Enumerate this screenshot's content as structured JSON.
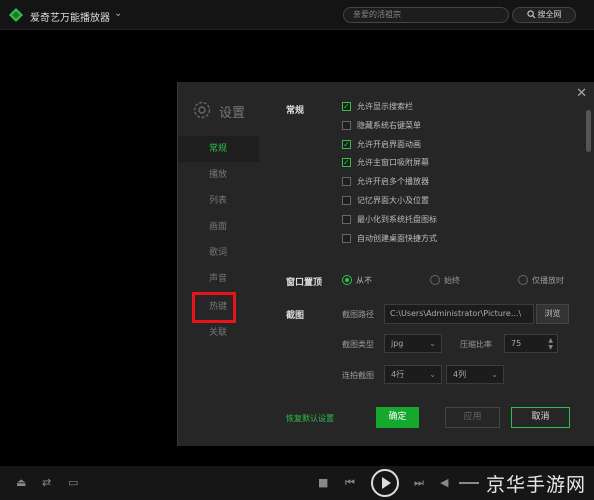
{
  "app": {
    "title": "爱奇艺万能播放器",
    "search_placeholder": "亲爱的活祖宗",
    "search_button": "搜全网"
  },
  "settings": {
    "title": "设置",
    "sidebar_items": [
      "常规",
      "播放",
      "列表",
      "画面",
      "歌词",
      "声音",
      "热键",
      "关联"
    ],
    "active_item": "常规",
    "general": {
      "label": "常规",
      "checkboxes": [
        {
          "label": "允许显示搜索栏",
          "checked": true
        },
        {
          "label": "隐藏系统右键菜单",
          "checked": false
        },
        {
          "label": "允许开启界面动画",
          "checked": true
        },
        {
          "label": "允许主窗口吸附屏幕",
          "checked": true
        },
        {
          "label": "允许开启多个播放器",
          "checked": false
        },
        {
          "label": "记忆界面大小及位置",
          "checked": false
        },
        {
          "label": "最小化到系统托盘图标",
          "checked": false
        },
        {
          "label": "自动创建桌面快捷方式",
          "checked": false
        }
      ]
    },
    "window_top": {
      "label": "窗口置顶",
      "options": [
        "从不",
        "始终",
        "仅播放时"
      ],
      "selected": "从不"
    },
    "screenshot": {
      "label": "截图",
      "path_label": "截图路径",
      "path_value": "C:\\Users\\Administrator\\Picture...\\",
      "browse_button": "浏览",
      "type_label": "截图类型",
      "type_value": "jpg",
      "compression_label": "压缩比率",
      "compression_value": "75",
      "burst_label": "连拍截图",
      "burst_rows": "4行",
      "burst_cols": "4列"
    },
    "restore_defaults": "恢复默认设置",
    "ok_button": "确定",
    "apply_button": "应用",
    "cancel_button": "取消"
  },
  "watermark": "京华手游网",
  "colors": {
    "accent": "#2ec04a",
    "highlight_box": "#e8141b",
    "dialog_bg": "#262626"
  }
}
